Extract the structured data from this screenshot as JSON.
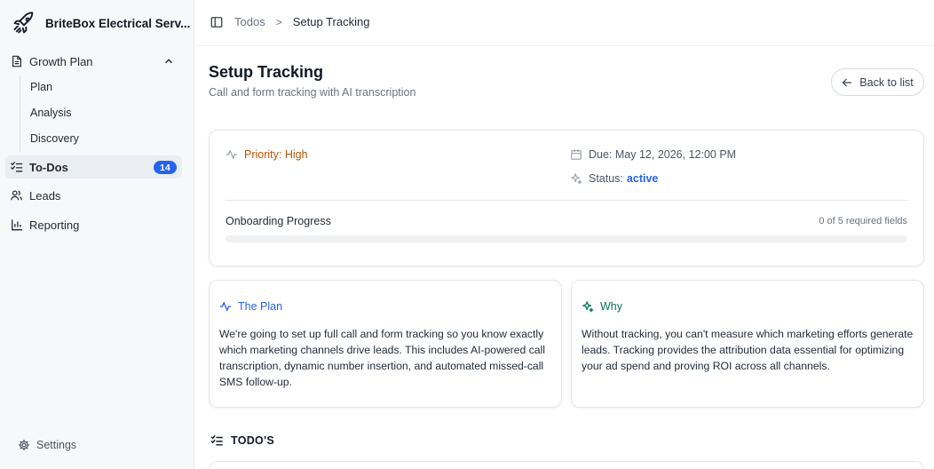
{
  "brand": {
    "name": "BriteBox Electrical Serv...",
    "logo_icon": "rocket-icon"
  },
  "sidebar": {
    "growth_plan": {
      "label": "Growth Plan",
      "icon": "document-icon"
    },
    "sub_items": [
      {
        "label": "Plan"
      },
      {
        "label": "Analysis"
      },
      {
        "label": "Discovery"
      }
    ],
    "todos": {
      "label": "To-Dos",
      "badge": "14",
      "icon": "checklist-icon"
    },
    "leads": {
      "label": "Leads",
      "icon": "users-icon"
    },
    "reporting": {
      "label": "Reporting",
      "icon": "bar-chart-icon"
    },
    "settings": {
      "label": "Settings",
      "icon": "gear-icon"
    }
  },
  "breadcrumb": {
    "parent": "Todos",
    "separator": ">",
    "current": "Setup Tracking"
  },
  "page": {
    "title": "Setup Tracking",
    "subtitle": "Call and form tracking with AI transcription",
    "back_label": "Back to list"
  },
  "overview": {
    "priority": "Priority: High",
    "due": "Due: May 12, 2026, 12:00 PM",
    "status_label": "Status:",
    "status_value": "active",
    "progress_label": "Onboarding Progress",
    "progress_count": "0 of 5 required fields",
    "progress_fraction": 0
  },
  "plan": {
    "title": "The Plan",
    "body": "We're going to set up full call and form tracking so you know exactly which marketing channels drive leads. This includes AI-powered call transcription, dynamic number insertion, and automated missed-call SMS follow-up."
  },
  "why": {
    "title": "Why",
    "body": "Without tracking, you can't measure which marketing efforts generate leads. Tracking provides the attribution data essential for optimizing your ad spend and proving ROI across all channels."
  },
  "todos_section": {
    "title": "TODO'S"
  },
  "colors": {
    "accent": "#2563eb",
    "priority": "#b45309",
    "why": "#047857"
  }
}
